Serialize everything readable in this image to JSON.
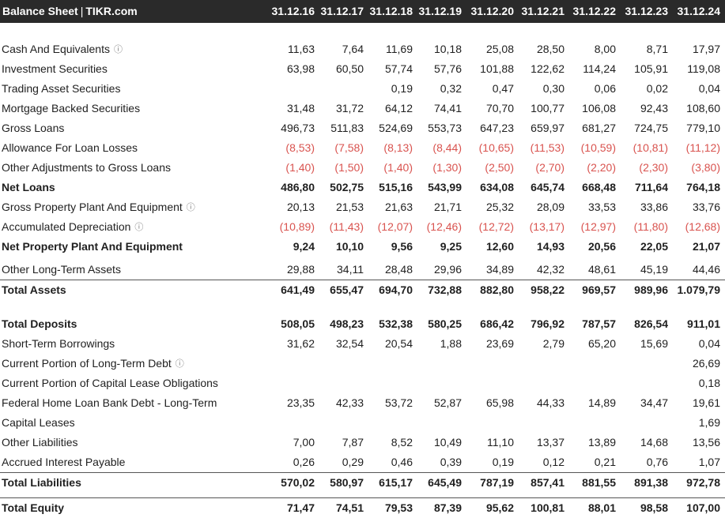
{
  "header": {
    "title": "Balance Sheet",
    "separator": "|",
    "source": "TIKR.com",
    "periods": [
      "31.12.16",
      "31.12.17",
      "31.12.18",
      "31.12.19",
      "31.12.20",
      "31.12.21",
      "31.12.22",
      "31.12.23",
      "31.12.24"
    ]
  },
  "icons": {
    "info": "info-circle-icon"
  },
  "colors": {
    "header_bg": "#2a2a2a",
    "negative": "#d9534f"
  },
  "rows": [
    {
      "label": "Cash And Equivalents",
      "info": true,
      "bold": false,
      "values": [
        "11,63",
        "7,64",
        "11,69",
        "10,18",
        "25,08",
        "28,50",
        "8,00",
        "8,71",
        "17,97"
      ]
    },
    {
      "label": "Investment Securities",
      "info": false,
      "bold": false,
      "values": [
        "63,98",
        "60,50",
        "57,74",
        "57,76",
        "101,88",
        "122,62",
        "114,24",
        "105,91",
        "119,08"
      ]
    },
    {
      "label": "Trading Asset Securities",
      "info": false,
      "bold": false,
      "values": [
        "",
        "",
        "0,19",
        "0,32",
        "0,47",
        "0,30",
        "0,06",
        "0,02",
        "0,04"
      ]
    },
    {
      "label": "Mortgage Backed Securities",
      "info": false,
      "bold": false,
      "values": [
        "31,48",
        "31,72",
        "64,12",
        "74,41",
        "70,70",
        "100,77",
        "106,08",
        "92,43",
        "108,60"
      ]
    },
    {
      "label": "Gross Loans",
      "info": false,
      "bold": false,
      "values": [
        "496,73",
        "511,83",
        "524,69",
        "553,73",
        "647,23",
        "659,97",
        "681,27",
        "724,75",
        "779,10"
      ]
    },
    {
      "label": "Allowance For Loan Losses",
      "info": false,
      "bold": false,
      "values": [
        "(8,53)",
        "(7,58)",
        "(8,13)",
        "(8,44)",
        "(10,65)",
        "(11,53)",
        "(10,59)",
        "(10,81)",
        "(11,12)"
      ]
    },
    {
      "label": "Other Adjustments to Gross Loans",
      "info": false,
      "bold": false,
      "values": [
        "(1,40)",
        "(1,50)",
        "(1,40)",
        "(1,30)",
        "(2,50)",
        "(2,70)",
        "(2,20)",
        "(2,30)",
        "(3,80)"
      ]
    },
    {
      "label": "Net Loans",
      "info": false,
      "bold": true,
      "values": [
        "486,80",
        "502,75",
        "515,16",
        "543,99",
        "634,08",
        "645,74",
        "668,48",
        "711,64",
        "764,18"
      ]
    },
    {
      "label": "Gross Property Plant And Equipment",
      "info": true,
      "bold": false,
      "values": [
        "20,13",
        "21,53",
        "21,63",
        "21,71",
        "25,32",
        "28,09",
        "33,53",
        "33,86",
        "33,76"
      ]
    },
    {
      "label": "Accumulated Depreciation",
      "info": true,
      "bold": false,
      "values": [
        "(10,89)",
        "(11,43)",
        "(12,07)",
        "(12,46)",
        "(12,72)",
        "(13,17)",
        "(12,97)",
        "(11,80)",
        "(12,68)"
      ]
    },
    {
      "label": "Net Property Plant And Equipment",
      "info": false,
      "bold": true,
      "values": [
        "9,24",
        "10,10",
        "9,56",
        "9,25",
        "12,60",
        "14,93",
        "20,56",
        "22,05",
        "21,07"
      ]
    },
    {
      "label": "Other Long-Term Assets",
      "info": false,
      "bold": false,
      "values": [
        "29,88",
        "34,11",
        "28,48",
        "29,96",
        "34,89",
        "42,32",
        "48,61",
        "45,19",
        "44,46"
      ]
    },
    {
      "label": "Total Assets",
      "info": false,
      "bold": true,
      "values": [
        "641,49",
        "655,47",
        "694,70",
        "732,88",
        "882,80",
        "958,22",
        "969,57",
        "989,96",
        "1.079,79"
      ]
    },
    {
      "label": "Total Deposits",
      "info": false,
      "bold": true,
      "values": [
        "508,05",
        "498,23",
        "532,38",
        "580,25",
        "686,42",
        "796,92",
        "787,57",
        "826,54",
        "911,01"
      ]
    },
    {
      "label": "Short-Term Borrowings",
      "info": false,
      "bold": false,
      "values": [
        "31,62",
        "32,54",
        "20,54",
        "1,88",
        "23,69",
        "2,79",
        "65,20",
        "15,69",
        "0,04"
      ]
    },
    {
      "label": "Current Portion of Long-Term Debt",
      "info": true,
      "bold": false,
      "values": [
        "",
        "",
        "",
        "",
        "",
        "",
        "",
        "",
        "26,69"
      ]
    },
    {
      "label": "Current Portion of Capital Lease Obligations",
      "info": false,
      "bold": false,
      "values": [
        "",
        "",
        "",
        "",
        "",
        "",
        "",
        "",
        "0,18"
      ]
    },
    {
      "label": "Federal Home Loan Bank Debt - Long-Term",
      "info": false,
      "bold": false,
      "values": [
        "23,35",
        "42,33",
        "53,72",
        "52,87",
        "65,98",
        "44,33",
        "14,89",
        "34,47",
        "19,61"
      ]
    },
    {
      "label": "Capital Leases",
      "info": false,
      "bold": false,
      "values": [
        "",
        "",
        "",
        "",
        "",
        "",
        "",
        "",
        "1,69"
      ]
    },
    {
      "label": "Other Liabilities",
      "info": false,
      "bold": false,
      "values": [
        "7,00",
        "7,87",
        "8,52",
        "10,49",
        "11,10",
        "13,37",
        "13,89",
        "14,68",
        "13,56"
      ]
    },
    {
      "label": "Accrued Interest Payable",
      "info": false,
      "bold": false,
      "values": [
        "0,26",
        "0,29",
        "0,46",
        "0,39",
        "0,19",
        "0,12",
        "0,21",
        "0,76",
        "1,07"
      ]
    },
    {
      "label": "Total Liabilities",
      "info": false,
      "bold": true,
      "values": [
        "570,02",
        "580,97",
        "615,17",
        "645,49",
        "787,19",
        "857,41",
        "881,55",
        "891,38",
        "972,78"
      ]
    },
    {
      "label": "Total Equity",
      "info": false,
      "bold": true,
      "values": [
        "71,47",
        "74,51",
        "79,53",
        "87,39",
        "95,62",
        "100,81",
        "88,01",
        "98,58",
        "107,00"
      ]
    }
  ]
}
